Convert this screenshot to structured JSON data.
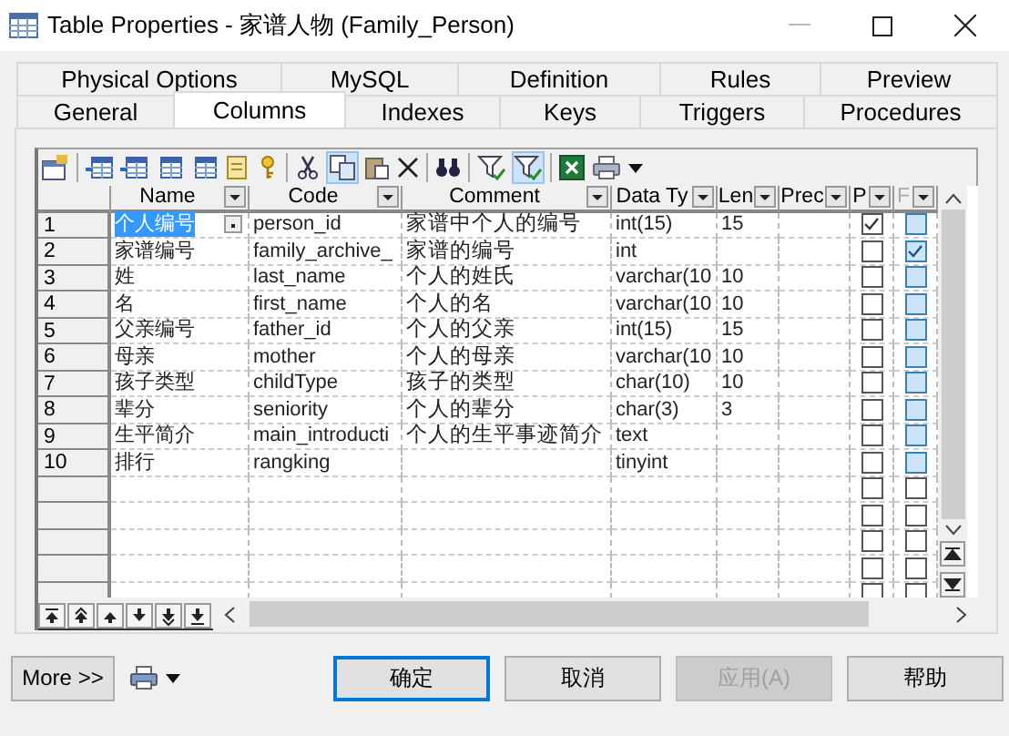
{
  "window": {
    "title": "Table Properties - 家谱人物 (Family_Person)"
  },
  "tab_rows": [
    [
      {
        "label": "Physical Options",
        "selected": false
      },
      {
        "label": "MySQL",
        "selected": false
      },
      {
        "label": "Definition",
        "selected": false
      },
      {
        "label": "Rules",
        "selected": false
      },
      {
        "label": "Preview",
        "selected": false
      }
    ],
    [
      {
        "label": "General",
        "selected": false
      },
      {
        "label": "Columns",
        "selected": true
      },
      {
        "label": "Indexes",
        "selected": false
      },
      {
        "label": "Keys",
        "selected": false
      },
      {
        "label": "Triggers",
        "selected": false
      },
      {
        "label": "Procedures",
        "selected": false
      }
    ]
  ],
  "table": {
    "columns": [
      {
        "label": "Name",
        "disabled": false
      },
      {
        "label": "Code",
        "disabled": false
      },
      {
        "label": "Comment",
        "disabled": false
      },
      {
        "label": "Data Ty",
        "disabled": false
      },
      {
        "label": "Len",
        "disabled": false
      },
      {
        "label": "Prec",
        "disabled": false
      },
      {
        "label": "P",
        "disabled": false
      },
      {
        "label": "F",
        "disabled": true
      }
    ],
    "rows": [
      {
        "number": "1",
        "name": "个人编号",
        "code": "person_id",
        "comment": "家谱中个人的编号",
        "data_type": "int(15)",
        "length": "15",
        "primary": true,
        "foreign": false,
        "selected": true
      },
      {
        "number": "2",
        "name": "家谱编号",
        "code": "family_archive_",
        "comment": "家谱的编号",
        "data_type": "int",
        "length": "",
        "primary": false,
        "foreign": true,
        "selected": false
      },
      {
        "number": "3",
        "name": "姓",
        "code": "last_name",
        "comment": "个人的姓氏",
        "data_type": "varchar(10",
        "length": "10",
        "primary": false,
        "foreign": false,
        "selected": false
      },
      {
        "number": "4",
        "name": "名",
        "code": "first_name",
        "comment": "个人的名",
        "data_type": "varchar(10",
        "length": "10",
        "primary": false,
        "foreign": false,
        "selected": false
      },
      {
        "number": "5",
        "name": "父亲编号",
        "code": "father_id",
        "comment": "个人的父亲",
        "data_type": "int(15)",
        "length": "15",
        "primary": false,
        "foreign": false,
        "selected": false
      },
      {
        "number": "6",
        "name": "母亲",
        "code": "mother",
        "comment": "个人的母亲",
        "data_type": "varchar(10",
        "length": "10",
        "primary": false,
        "foreign": false,
        "selected": false
      },
      {
        "number": "7",
        "name": "孩子类型",
        "code": "childType",
        "comment": "孩子的类型",
        "data_type": "char(10)",
        "length": "10",
        "primary": false,
        "foreign": false,
        "selected": false
      },
      {
        "number": "8",
        "name": "辈分",
        "code": "seniority",
        "comment": "个人的辈分",
        "data_type": "char(3)",
        "length": "3",
        "primary": false,
        "foreign": false,
        "selected": false
      },
      {
        "number": "9",
        "name": "生平简介",
        "code": "main_introducti",
        "comment": "个人的生平事迹简介",
        "data_type": "text",
        "length": "",
        "primary": false,
        "foreign": false,
        "selected": false
      },
      {
        "number": "10",
        "name": "排行",
        "code": "rangking",
        "comment": "",
        "data_type": "tinyint",
        "length": "",
        "primary": false,
        "foreign": false,
        "selected": false
      }
    ]
  },
  "blank_rows": [
    {
      "primary": false,
      "foreign": false
    },
    {
      "primary": false,
      "foreign": false
    },
    {
      "primary": false,
      "foreign": false
    },
    {
      "primary": false,
      "foreign": false
    },
    {
      "primary": false,
      "foreign": false
    }
  ],
  "buttons": [
    {
      "label": "More >>",
      "kind": "more",
      "disabled": false
    },
    {
      "label": "确定",
      "kind": "default",
      "disabled": false
    },
    {
      "label": "取消",
      "kind": "normal",
      "disabled": false
    },
    {
      "label": "应用(A)",
      "kind": "normal",
      "disabled": true
    },
    {
      "label": "帮助",
      "kind": "normal",
      "disabled": false
    }
  ]
}
